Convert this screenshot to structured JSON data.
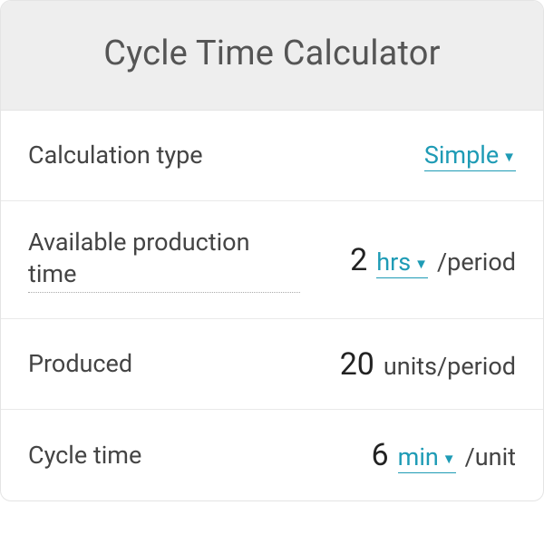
{
  "header": {
    "title": "Cycle Time Calculator"
  },
  "rows": {
    "calc_type": {
      "label": "Calculation type",
      "value_link": "Simple"
    },
    "prod_time": {
      "label": "Available production time",
      "value": "2",
      "unit_link": "hrs",
      "suffix": "/period"
    },
    "produced": {
      "label": "Produced",
      "value": "20",
      "suffix": "units/period"
    },
    "cycle_time": {
      "label": "Cycle time",
      "value": "6",
      "unit_link": "min",
      "suffix": "/unit"
    }
  },
  "chart_data": {
    "type": "table",
    "title": "Cycle Time Calculator",
    "rows": [
      {
        "field": "Calculation type",
        "value": "Simple"
      },
      {
        "field": "Available production time",
        "value": 2,
        "unit": "hrs/period"
      },
      {
        "field": "Produced",
        "value": 20,
        "unit": "units/period"
      },
      {
        "field": "Cycle time",
        "value": 6,
        "unit": "min/unit"
      }
    ]
  }
}
